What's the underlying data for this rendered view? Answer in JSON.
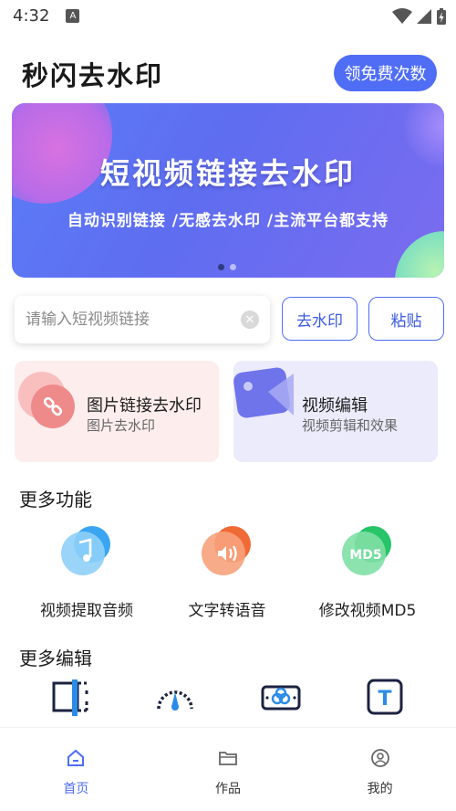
{
  "status_bar": {
    "time": "4:32",
    "notif_glyph": "A"
  },
  "header": {
    "title": "秒闪去水印",
    "free_button": "领免费次数"
  },
  "banner": {
    "title": "短视频链接去水印",
    "subtitle": "自动识别链接 /无感去水印 /主流平台都支持"
  },
  "link_input": {
    "placeholder": "请输入短视频链接",
    "value": ""
  },
  "actions": {
    "remove_watermark": "去水印",
    "paste": "粘贴"
  },
  "cards": [
    {
      "title": "图片链接去水印",
      "subtitle": "图片去水印",
      "icon": "link-icon"
    },
    {
      "title": "视频编辑",
      "subtitle": "视频剪辑和效果",
      "icon": "video-play-icon"
    }
  ],
  "more_functions": {
    "title": "更多功能",
    "items": [
      {
        "label": "视频提取音频",
        "icon": "music-note-icon"
      },
      {
        "label": "文字转语音",
        "icon": "sound-wave-icon"
      },
      {
        "label": "修改视频MD5",
        "icon": "md5-icon",
        "icon_text": "MD5"
      }
    ]
  },
  "more_edit": {
    "title": "更多编辑",
    "items": [
      {
        "icon": "crop-icon"
      },
      {
        "icon": "speed-gauge-icon"
      },
      {
        "icon": "filter-icon"
      },
      {
        "icon": "text-icon",
        "icon_text": "T"
      }
    ]
  },
  "bottom_nav": [
    {
      "label": "首页",
      "icon": "home-icon",
      "active": true
    },
    {
      "label": "作品",
      "icon": "folder-icon",
      "active": false
    },
    {
      "label": "我的",
      "icon": "profile-icon",
      "active": false
    }
  ],
  "colors": {
    "accent": "#4f6ef5",
    "card_pink": "#fdeeed",
    "card_lavender": "#ebebfb"
  }
}
